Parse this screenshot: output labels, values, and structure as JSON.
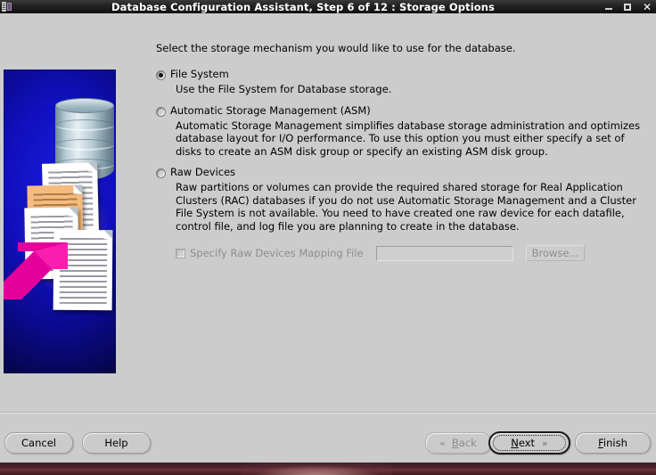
{
  "window": {
    "title": "Database Configuration Assistant, Step 6 of 12 : Storage Options",
    "icon": "window-menu-icon",
    "controls": {
      "minimize": "–",
      "maximize": "□",
      "close": "✕"
    }
  },
  "side_graphic": {
    "alt": "database-storage-illustration",
    "background_color": "#0b0bb4",
    "arrow_color": "#e5009b"
  },
  "content": {
    "intro": "Select the storage mechanism you would like to use for the database.",
    "options": [
      {
        "id": "file-system",
        "label": "File System",
        "selected": true,
        "description": "Use the File System for Database storage."
      },
      {
        "id": "asm",
        "label": "Automatic Storage Management (ASM)",
        "selected": false,
        "description": "Automatic Storage Management simplifies database storage administration and optimizes database layout for I/O performance. To use this option you must either specify a set of disks to create an ASM disk group or specify an existing ASM disk group."
      },
      {
        "id": "raw-devices",
        "label": "Raw Devices",
        "selected": false,
        "description": "Raw partitions or volumes can provide the required shared storage for Real Application Clusters (RAC) databases if you do not use Automatic Storage Management and a Cluster File System is not available.  You need to have created one raw device for each datafile, control file, and log file you are planning to create in the database."
      }
    ],
    "mapping": {
      "checkbox_label": "Specify Raw Devices Mapping File",
      "checked": false,
      "enabled": false,
      "input_value": "",
      "input_placeholder": "",
      "browse_label": "Browse..."
    }
  },
  "buttons": {
    "cancel": "Cancel",
    "help": "Help",
    "back": "Back",
    "back_mnemonic": "B",
    "back_chevron": "«",
    "next": "Next",
    "next_mnemonic": "N",
    "next_chevron": "»",
    "finish": "Finish",
    "finish_mnemonic": "F"
  }
}
